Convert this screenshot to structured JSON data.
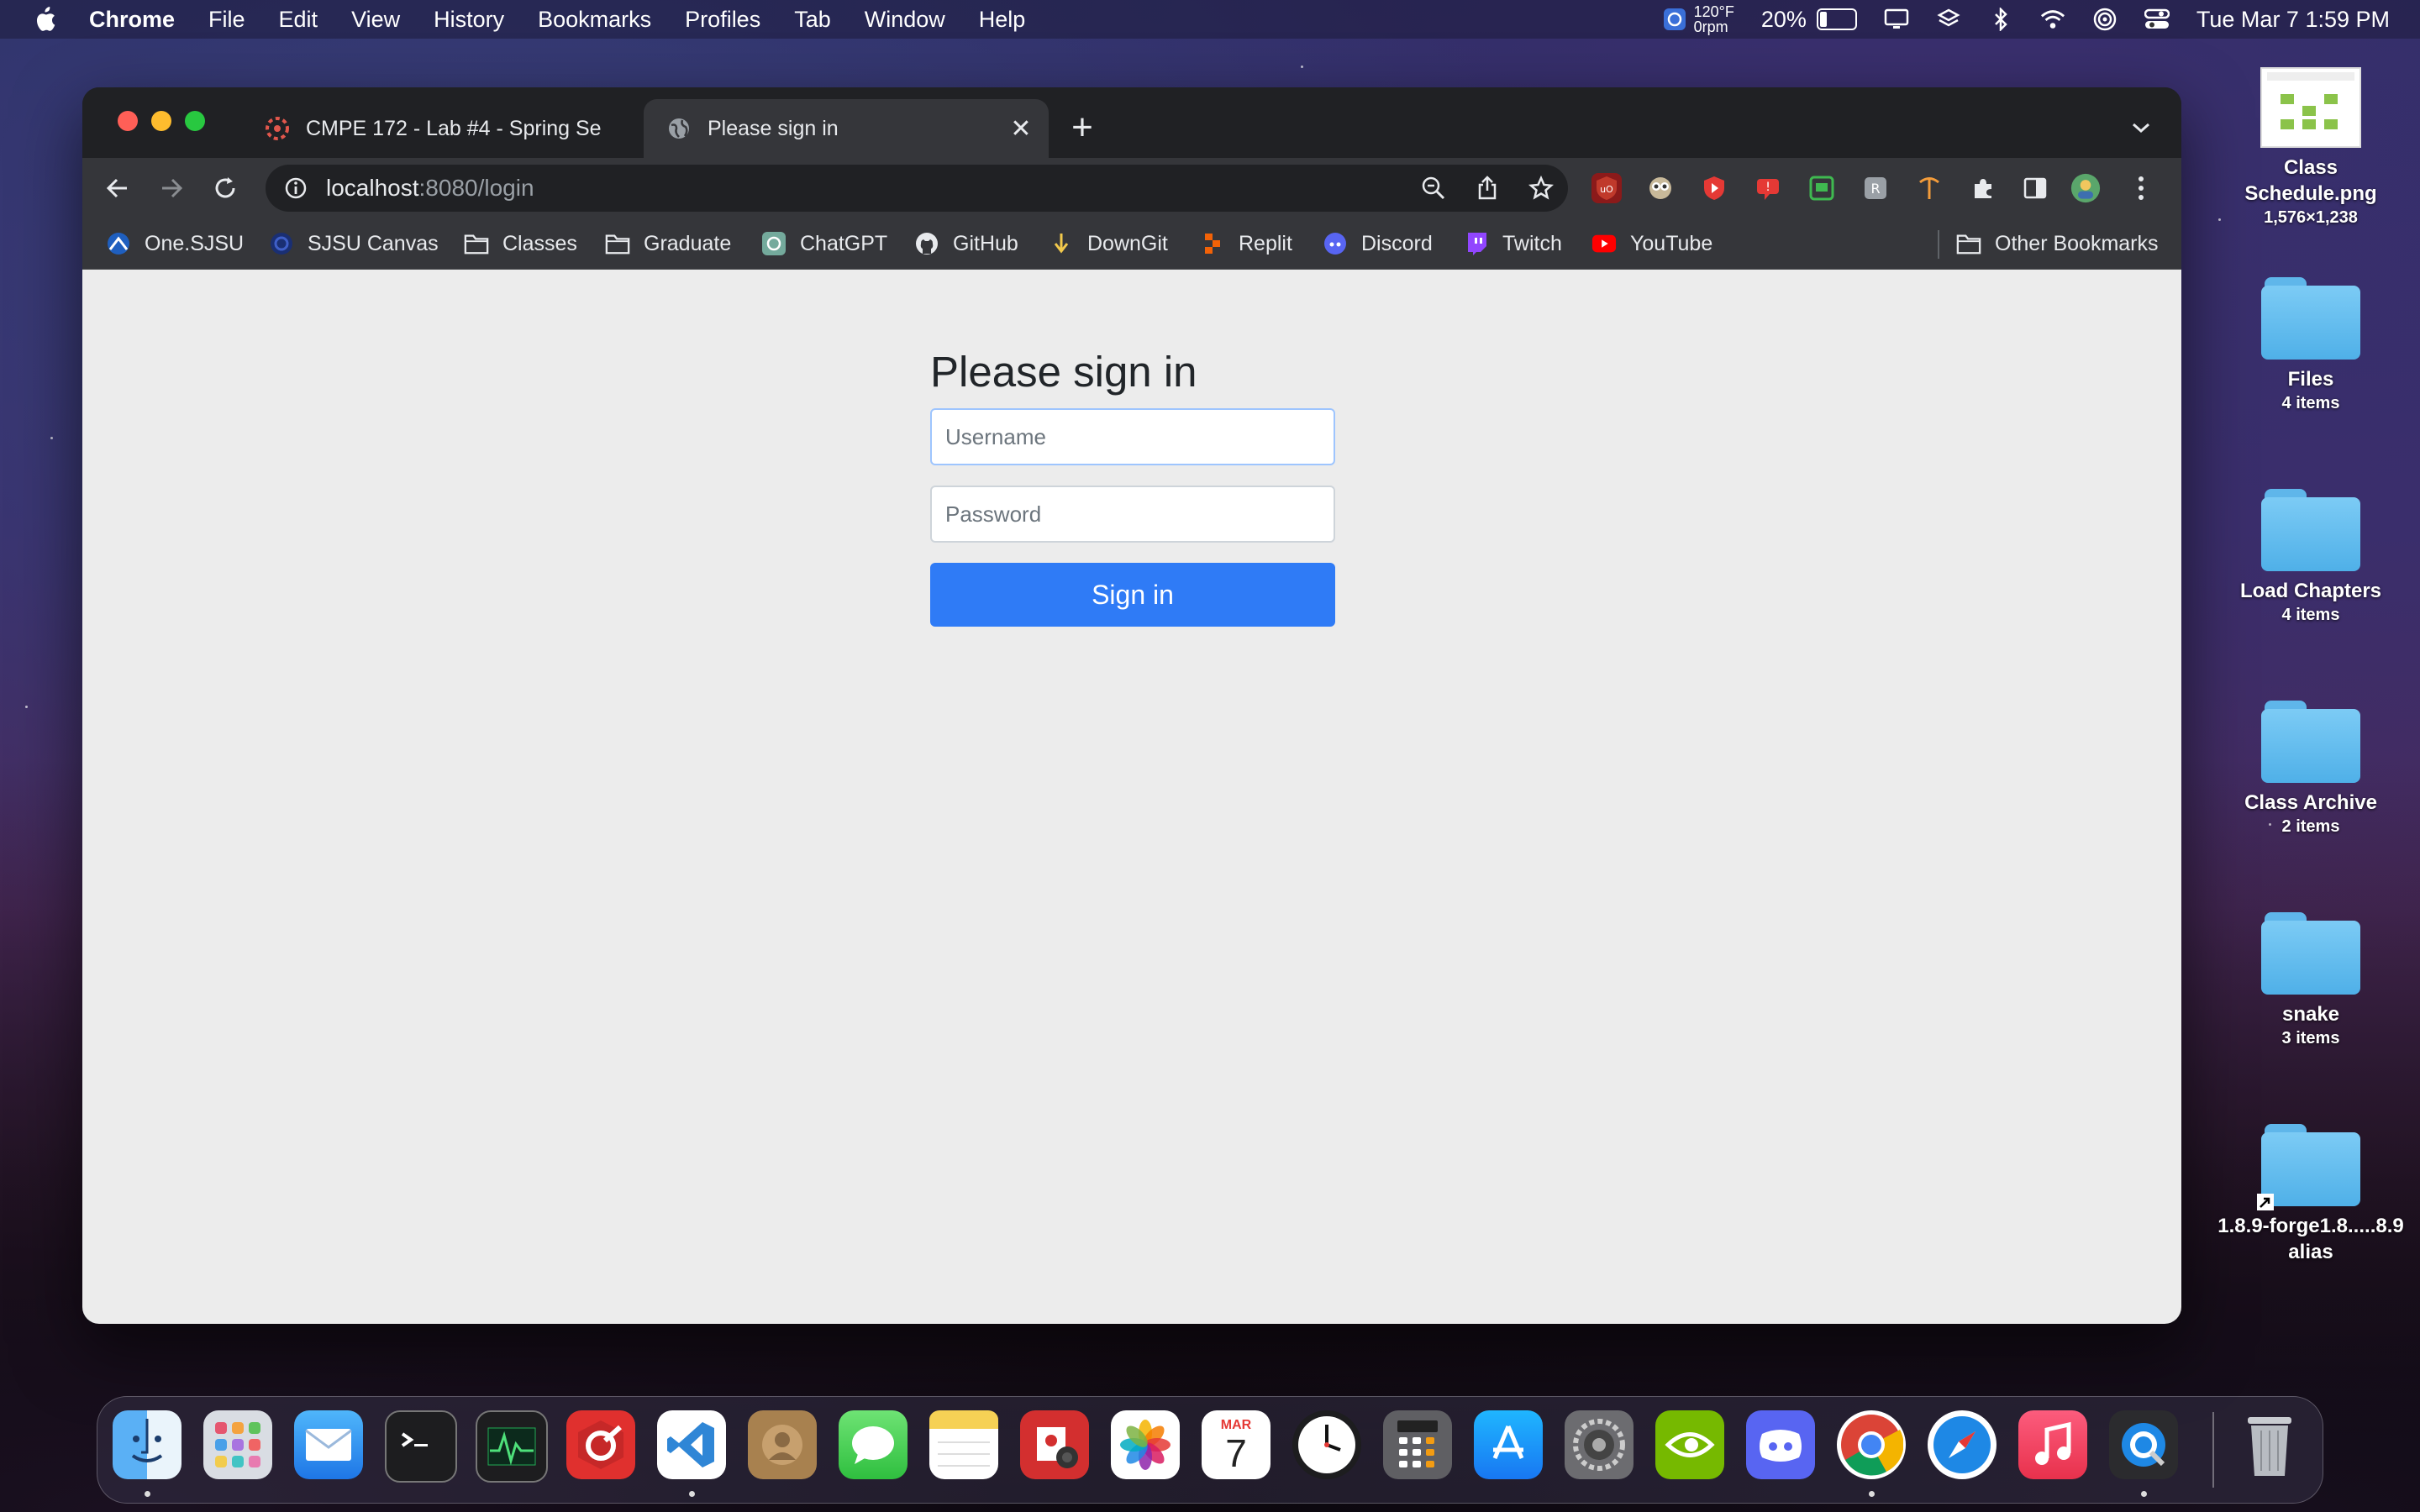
{
  "menubar": {
    "app": "Chrome",
    "items": [
      "File",
      "Edit",
      "View",
      "History",
      "Bookmarks",
      "Profiles",
      "Tab",
      "Window",
      "Help"
    ],
    "temp": "120°F",
    "rpm": "0rpm",
    "battery_pct": "20%",
    "battery_level": 0.2,
    "datetime": "Tue Mar 7  1:59 PM"
  },
  "tabs": [
    {
      "title": "CMPE 172 - Lab #4 - Spring Se",
      "close": "✕"
    },
    {
      "title": "Please sign in",
      "close": "✕"
    }
  ],
  "newtab": "+",
  "omnibox": {
    "host": "localhost",
    "rest": ":8080/login"
  },
  "bookmarks": [
    "One.SJSU",
    "SJSU Canvas",
    "Classes",
    "Graduate",
    "ChatGPT",
    "GitHub",
    "DownGit",
    "Replit",
    "Discord",
    "Twitch",
    "YouTube"
  ],
  "other_bookmarks": "Other Bookmarks",
  "login": {
    "heading": "Please sign in",
    "username_placeholder": "Username",
    "password_placeholder": "Password",
    "button": "Sign in"
  },
  "desktop": [
    {
      "name": "Class Schedule.png",
      "sub": "1,576×1,238",
      "kind": "image"
    },
    {
      "name": "Files",
      "sub": "4 items",
      "kind": "folder"
    },
    {
      "name": "Load Chapters",
      "sub": "4 items",
      "kind": "folder"
    },
    {
      "name": "Class Archive",
      "sub": "2 items",
      "kind": "folder"
    },
    {
      "name": "snake",
      "sub": "3 items",
      "kind": "folder"
    },
    {
      "name": "1.8.9-forge1.8.....8.9 alias",
      "sub": "",
      "kind": "alias"
    }
  ],
  "calendar": {
    "month": "MAR",
    "day": "7"
  },
  "colors": {
    "accent": "#2f7bf6",
    "window_bg": "#ececec",
    "chrome_dark": "#202124",
    "toolbar": "#35363a"
  }
}
